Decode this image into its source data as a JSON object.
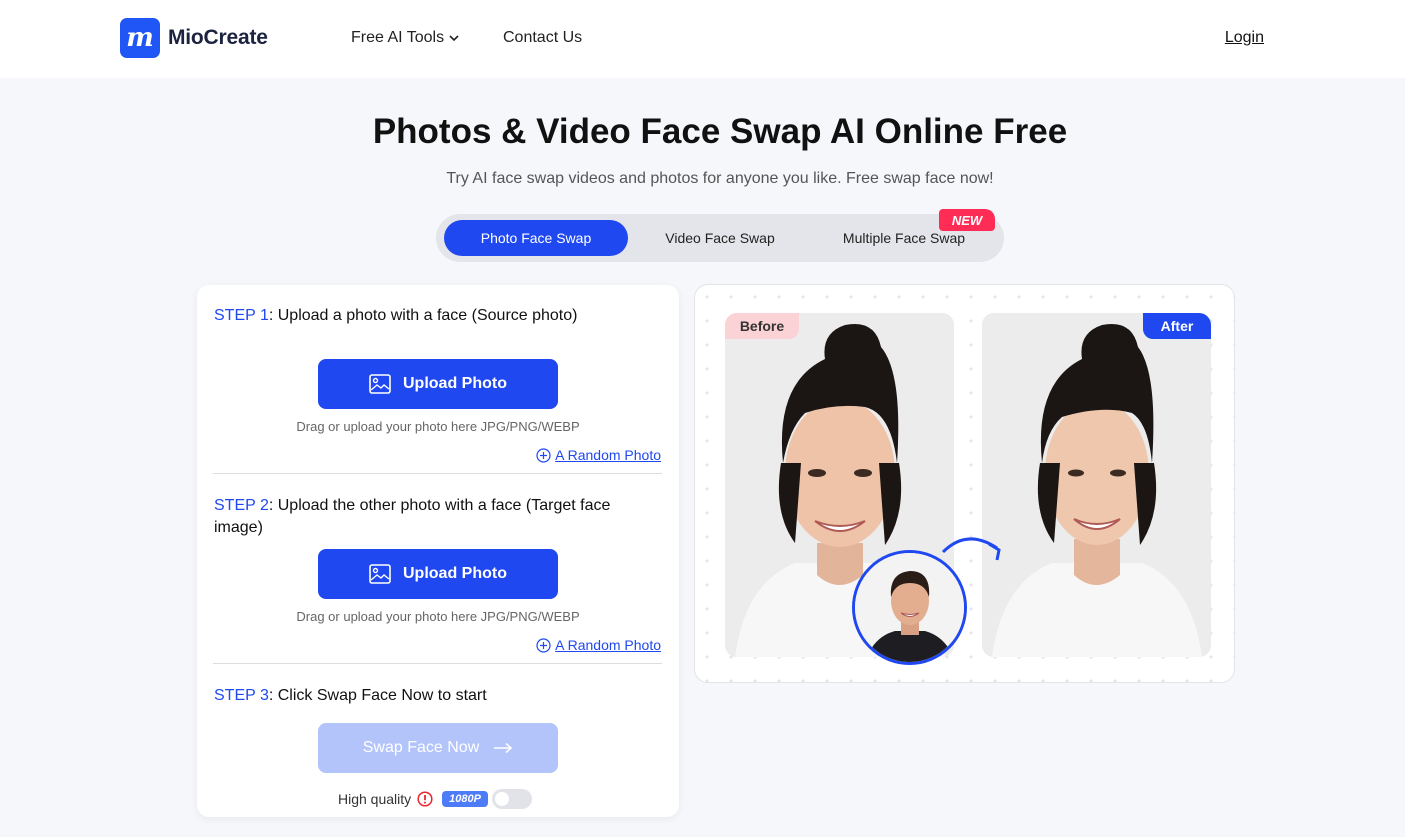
{
  "header": {
    "logo_mark": "m",
    "logo_text": "MioCreate",
    "nav": {
      "tools": "Free AI Tools",
      "contact": "Contact Us"
    },
    "login": "Login"
  },
  "hero": {
    "title": "Photos & Video Face Swap AI Online Free",
    "subtitle": "Try AI face swap videos and photos for anyone you like. Free swap face now!"
  },
  "tabs": {
    "photo": "Photo Face Swap",
    "video": "Video Face Swap",
    "multiple": "Multiple Face Swap",
    "new_badge": "NEW"
  },
  "steps": {
    "step1": {
      "num": "STEP 1",
      "text": ": Upload a photo with a face (Source photo)"
    },
    "step2": {
      "num": "STEP 2",
      "text": ": Upload the other photo with a face (Target face image)"
    },
    "step3": {
      "num": "STEP 3",
      "text": ": Click Swap Face Now to start"
    },
    "upload_label": "Upload Photo",
    "hint": "Drag or upload your photo here JPG/PNG/WEBP",
    "random": "A Random Photo",
    "swap_label": "Swap Face Now",
    "quality_label": "High quality",
    "quality_badge": "1080P"
  },
  "preview": {
    "before": "Before",
    "after": "After"
  },
  "colors": {
    "accent": "#1f48f0",
    "new_badge": "#ff2d55",
    "disabled_button": "#b3c4fb"
  }
}
